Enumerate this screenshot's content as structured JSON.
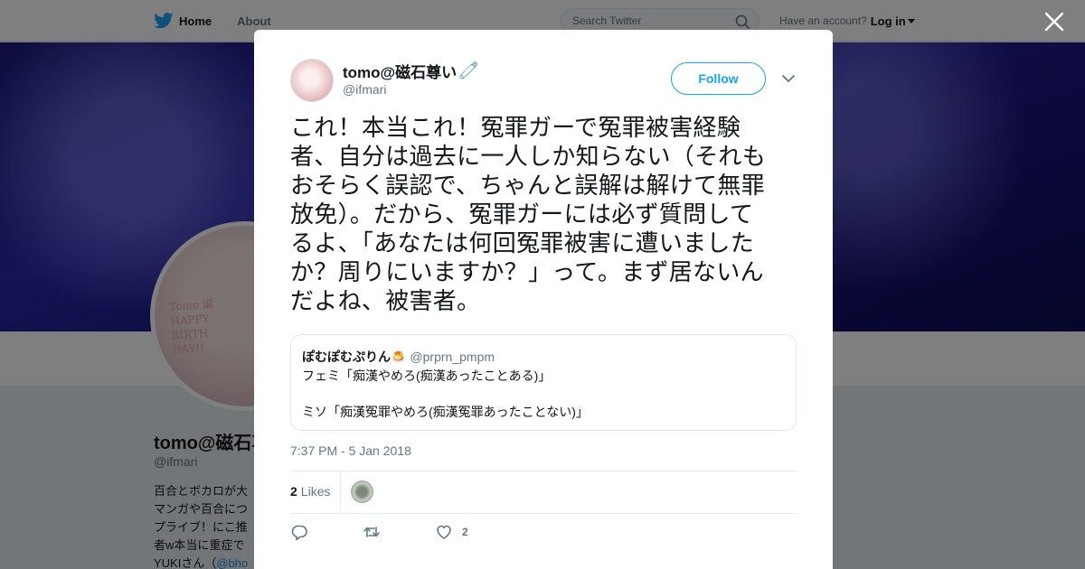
{
  "topbar": {
    "home_label": "Home",
    "about_label": "About",
    "search_placeholder": "Search Twitter",
    "account_prompt": "Have an account?",
    "login_label": "Log in"
  },
  "profile": {
    "display_name": "tomo@磁石尊い",
    "handle": "@ifmari",
    "bio_lines": [
      "百合とボカロが大",
      "マンガや百合につ",
      "プライブ！にこ推",
      "者w本当に重症で"
    ],
    "bio_last_prefix": "YUKIさん（",
    "bio_last_link": "@bho",
    "avatar_text": "Tomo 誕\nHAPPY\nBIRTH\nDAY!!"
  },
  "tweet": {
    "author_name": "tomo@磁石尊い",
    "author_emoji": "🧷",
    "author_handle": "@ifmari",
    "follow_label": "Follow",
    "text": "これ！本当これ！冤罪ガーで冤罪被害経験\n者、自分は過去に一人しか知らない（それも\nおそらく誤認で、ちゃんと誤解は解けて無罪\n放免）。だから、冤罪ガーには必ず質問して\nるよ、「あなたは何回冤罪被害に遭いました\nか？周りにいますか？」って。まず居ないん\nだよね、被害者。",
    "timestamp": "7:37 PM - 5 Jan 2018",
    "likes_count": "2",
    "likes_label": "Likes",
    "like_action_count": "2"
  },
  "quote": {
    "name": "ぽむぽむぷりん🍮",
    "handle": "@prprn_pmpm",
    "line1": "フェミ「痴漢やめろ(痴漢あったことある)」",
    "line2": "ミソ「痴漢冤罪やめろ(痴漢冤罪あったことない)」"
  },
  "icons": {
    "brand": "twitter-bird-icon",
    "search": "search-icon",
    "close": "close-icon",
    "more": "chevron-down-icon",
    "reply": "reply-icon",
    "retweet": "retweet-icon",
    "like": "heart-icon"
  },
  "colors": {
    "accent": "#1da1f2",
    "text": "#14171a",
    "muted": "#657786",
    "banner": "#2a28a8"
  }
}
